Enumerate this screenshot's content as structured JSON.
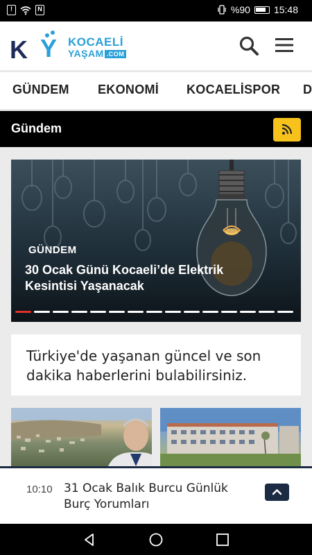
{
  "status_bar": {
    "battery": "%90",
    "time": "15:48"
  },
  "header": {
    "logo_line1": "KOCAELİ",
    "logo_line2": "YAŞAM",
    "logo_suffix": ".COM",
    "accent_color": "#2aa0d8"
  },
  "nav": {
    "items": [
      "GÜNDEM",
      "EKONOMİ",
      "KOCAELİSPOR",
      "D"
    ]
  },
  "section": {
    "title": "Gündem",
    "rss_color": "#f7c21b"
  },
  "hero": {
    "category": "GÜNDEM",
    "title": "30 Ocak Günü Kocaeli’de Elektrik Kesintisi Yaşanacak",
    "slide_count": 15,
    "active_slide": 1,
    "active_dot_color": "#e0302a"
  },
  "info": {
    "text": "Türkiye'de yaşanan güncel ve son dakika haberlerini bulabilirsiniz."
  },
  "ticker": {
    "time": "10:10",
    "text": "31 Ocak Balık Burcu Günlük Burç Yorumları"
  },
  "icons": {
    "search": "search-icon",
    "menu": "hamburger-icon",
    "rss": "rss-icon",
    "up": "chevron-up-icon",
    "back": "back-triangle-icon",
    "home": "home-circle-icon",
    "recents": "recents-square-icon"
  }
}
